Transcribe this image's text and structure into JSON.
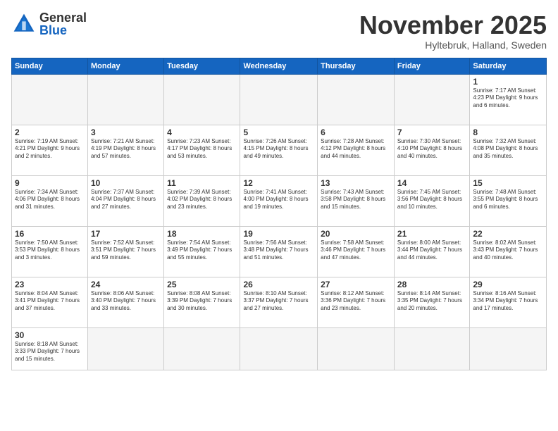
{
  "logo": {
    "general": "General",
    "blue": "Blue"
  },
  "title": "November 2025",
  "subtitle": "Hyltebruk, Halland, Sweden",
  "days_of_week": [
    "Sunday",
    "Monday",
    "Tuesday",
    "Wednesday",
    "Thursday",
    "Friday",
    "Saturday"
  ],
  "weeks": [
    [
      {
        "day": "",
        "info": ""
      },
      {
        "day": "",
        "info": ""
      },
      {
        "day": "",
        "info": ""
      },
      {
        "day": "",
        "info": ""
      },
      {
        "day": "",
        "info": ""
      },
      {
        "day": "",
        "info": ""
      },
      {
        "day": "1",
        "info": "Sunrise: 7:17 AM\nSunset: 4:23 PM\nDaylight: 9 hours and 6 minutes."
      }
    ],
    [
      {
        "day": "2",
        "info": "Sunrise: 7:19 AM\nSunset: 4:21 PM\nDaylight: 9 hours and 2 minutes."
      },
      {
        "day": "3",
        "info": "Sunrise: 7:21 AM\nSunset: 4:19 PM\nDaylight: 8 hours and 57 minutes."
      },
      {
        "day": "4",
        "info": "Sunrise: 7:23 AM\nSunset: 4:17 PM\nDaylight: 8 hours and 53 minutes."
      },
      {
        "day": "5",
        "info": "Sunrise: 7:26 AM\nSunset: 4:15 PM\nDaylight: 8 hours and 49 minutes."
      },
      {
        "day": "6",
        "info": "Sunrise: 7:28 AM\nSunset: 4:12 PM\nDaylight: 8 hours and 44 minutes."
      },
      {
        "day": "7",
        "info": "Sunrise: 7:30 AM\nSunset: 4:10 PM\nDaylight: 8 hours and 40 minutes."
      },
      {
        "day": "8",
        "info": "Sunrise: 7:32 AM\nSunset: 4:08 PM\nDaylight: 8 hours and 35 minutes."
      }
    ],
    [
      {
        "day": "9",
        "info": "Sunrise: 7:34 AM\nSunset: 4:06 PM\nDaylight: 8 hours and 31 minutes."
      },
      {
        "day": "10",
        "info": "Sunrise: 7:37 AM\nSunset: 4:04 PM\nDaylight: 8 hours and 27 minutes."
      },
      {
        "day": "11",
        "info": "Sunrise: 7:39 AM\nSunset: 4:02 PM\nDaylight: 8 hours and 23 minutes."
      },
      {
        "day": "12",
        "info": "Sunrise: 7:41 AM\nSunset: 4:00 PM\nDaylight: 8 hours and 19 minutes."
      },
      {
        "day": "13",
        "info": "Sunrise: 7:43 AM\nSunset: 3:58 PM\nDaylight: 8 hours and 15 minutes."
      },
      {
        "day": "14",
        "info": "Sunrise: 7:45 AM\nSunset: 3:56 PM\nDaylight: 8 hours and 10 minutes."
      },
      {
        "day": "15",
        "info": "Sunrise: 7:48 AM\nSunset: 3:55 PM\nDaylight: 8 hours and 6 minutes."
      }
    ],
    [
      {
        "day": "16",
        "info": "Sunrise: 7:50 AM\nSunset: 3:53 PM\nDaylight: 8 hours and 3 minutes."
      },
      {
        "day": "17",
        "info": "Sunrise: 7:52 AM\nSunset: 3:51 PM\nDaylight: 7 hours and 59 minutes."
      },
      {
        "day": "18",
        "info": "Sunrise: 7:54 AM\nSunset: 3:49 PM\nDaylight: 7 hours and 55 minutes."
      },
      {
        "day": "19",
        "info": "Sunrise: 7:56 AM\nSunset: 3:48 PM\nDaylight: 7 hours and 51 minutes."
      },
      {
        "day": "20",
        "info": "Sunrise: 7:58 AM\nSunset: 3:46 PM\nDaylight: 7 hours and 47 minutes."
      },
      {
        "day": "21",
        "info": "Sunrise: 8:00 AM\nSunset: 3:44 PM\nDaylight: 7 hours and 44 minutes."
      },
      {
        "day": "22",
        "info": "Sunrise: 8:02 AM\nSunset: 3:43 PM\nDaylight: 7 hours and 40 minutes."
      }
    ],
    [
      {
        "day": "23",
        "info": "Sunrise: 8:04 AM\nSunset: 3:41 PM\nDaylight: 7 hours and 37 minutes."
      },
      {
        "day": "24",
        "info": "Sunrise: 8:06 AM\nSunset: 3:40 PM\nDaylight: 7 hours and 33 minutes."
      },
      {
        "day": "25",
        "info": "Sunrise: 8:08 AM\nSunset: 3:39 PM\nDaylight: 7 hours and 30 minutes."
      },
      {
        "day": "26",
        "info": "Sunrise: 8:10 AM\nSunset: 3:37 PM\nDaylight: 7 hours and 27 minutes."
      },
      {
        "day": "27",
        "info": "Sunrise: 8:12 AM\nSunset: 3:36 PM\nDaylight: 7 hours and 23 minutes."
      },
      {
        "day": "28",
        "info": "Sunrise: 8:14 AM\nSunset: 3:35 PM\nDaylight: 7 hours and 20 minutes."
      },
      {
        "day": "29",
        "info": "Sunrise: 8:16 AM\nSunset: 3:34 PM\nDaylight: 7 hours and 17 minutes."
      }
    ],
    [
      {
        "day": "30",
        "info": "Sunrise: 8:18 AM\nSunset: 3:33 PM\nDaylight: 7 hours and 15 minutes."
      },
      {
        "day": "",
        "info": ""
      },
      {
        "day": "",
        "info": ""
      },
      {
        "day": "",
        "info": ""
      },
      {
        "day": "",
        "info": ""
      },
      {
        "day": "",
        "info": ""
      },
      {
        "day": "",
        "info": ""
      }
    ]
  ],
  "colors": {
    "header_bg": "#1565c0",
    "header_text": "#ffffff",
    "border": "#cccccc"
  }
}
